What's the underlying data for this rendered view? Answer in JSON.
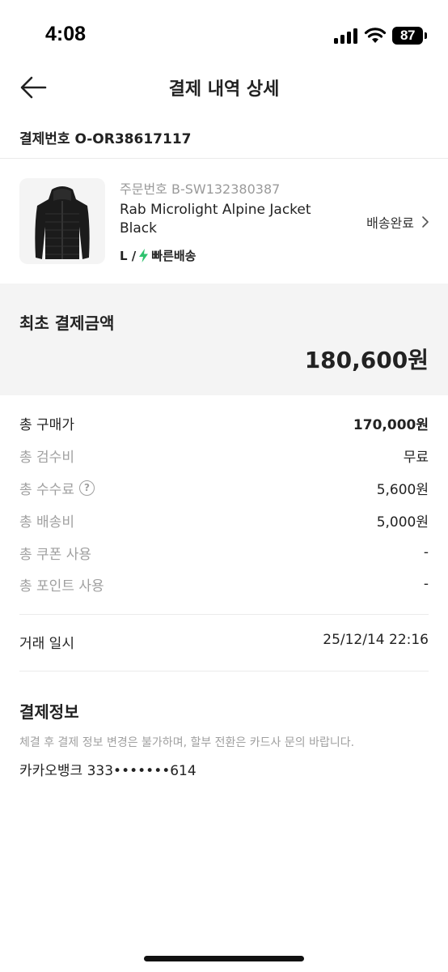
{
  "status_bar": {
    "time": "4:08",
    "battery": "87"
  },
  "header": {
    "title": "결제 내역 상세"
  },
  "payment_number": {
    "text": "결제번호 O-OR38617117"
  },
  "product": {
    "order_number": "주문번호 B-SW132380387",
    "name": "Rab Microlight Alpine Jacket Black",
    "size": "L /",
    "shipping_type": "빠른배송",
    "status": "배송완료",
    "accent_color": "#2ec26e"
  },
  "total": {
    "label": "최초 결제금액",
    "amount": "180,600원"
  },
  "breakdown": [
    {
      "label": "총 구매가",
      "value": "170,000원"
    },
    {
      "label": "총 검수비",
      "value": "무료"
    },
    {
      "label": "총 수수료",
      "value": "5,600원",
      "icon": "question-circle"
    },
    {
      "label": "총 배송비",
      "value": "5,000원"
    },
    {
      "label": "총 쿠폰 사용",
      "value": "-"
    },
    {
      "label": "총 포인트 사용",
      "value": "-"
    }
  ],
  "trade": {
    "label": "거래 일시",
    "value": "25/12/14 22:16"
  },
  "payment_info": {
    "title": "결제정보",
    "note": "체결 후 결제 정보 변경은 불가하며, 할부 전환은 카드사 문의 바랍니다.",
    "method": "카카오뱅크 333•••••••614"
  }
}
